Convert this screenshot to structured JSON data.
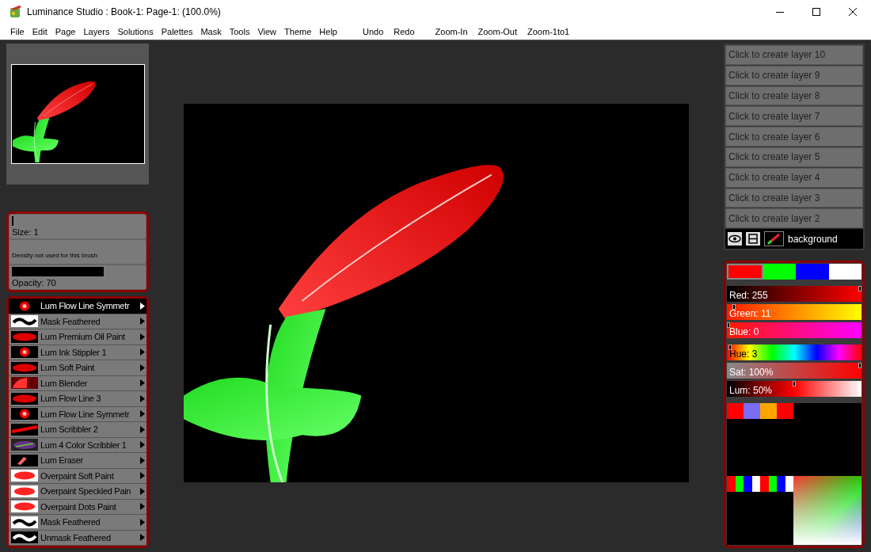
{
  "window": {
    "title": "Luminance Studio : Book-1: Page-1:  (100.0%)"
  },
  "menu": [
    "File",
    "Edit",
    "Page",
    "Layers",
    "Solutions",
    "Palettes",
    "Mask",
    "Tools",
    "View",
    "Theme",
    "Help"
  ],
  "toolbar": [
    "Undo",
    "Redo",
    "Zoom-In",
    "Zoom-Out",
    "Zoom-1to1"
  ],
  "brush_settings": {
    "size": {
      "label": "Size: 1",
      "level": 0.01
    },
    "density_note": "Density not used for this brush",
    "opacity": {
      "label": "Opacity: 70",
      "level": 0.7
    }
  },
  "brushes": [
    {
      "name": "Lum Flow Line Symmetr",
      "kind": "burst",
      "selected": true
    },
    {
      "name": "Mask Feathered",
      "kind": "wave-dark",
      "selected": false
    },
    {
      "name": "Lum Premium Oil Paint",
      "kind": "soft",
      "selected": false
    },
    {
      "name": "Lum Ink Stippler 1",
      "kind": "burst",
      "selected": false
    },
    {
      "name": "Lum Soft Paint",
      "kind": "soft",
      "selected": false
    },
    {
      "name": "Lum Blender",
      "kind": "blend",
      "selected": false
    },
    {
      "name": "Lum Flow Line 3",
      "kind": "soft",
      "selected": false
    },
    {
      "name": "Lum Flow Line Symmetr",
      "kind": "burst",
      "selected": false
    },
    {
      "name": "Lum Scribbler 2",
      "kind": "streak",
      "selected": false
    },
    {
      "name": "Lum 4 Color Scribbler 1",
      "kind": "multi",
      "selected": false
    },
    {
      "name": "Lum Eraser",
      "kind": "eraser",
      "selected": false
    },
    {
      "name": "Overpaint Soft Paint",
      "kind": "overpaint",
      "selected": false
    },
    {
      "name": "Overpaint Speckled Pain",
      "kind": "overpaint",
      "selected": false
    },
    {
      "name": "Overpaint Dots Paint",
      "kind": "overpaint",
      "selected": false
    },
    {
      "name": "Mask Feathered",
      "kind": "wave-dark",
      "selected": false
    },
    {
      "name": "Unmask Feathered",
      "kind": "wave-light",
      "selected": false
    }
  ],
  "layers": [
    {
      "label": "Click to create layer 10",
      "selected": false
    },
    {
      "label": "Click to create layer 9",
      "selected": false
    },
    {
      "label": "Click to create layer 8",
      "selected": false
    },
    {
      "label": "Click to create layer 7",
      "selected": false
    },
    {
      "label": "Click to create layer 6",
      "selected": false
    },
    {
      "label": "Click to create layer 5",
      "selected": false
    },
    {
      "label": "Click to create layer 4",
      "selected": false
    },
    {
      "label": "Click to create layer 3",
      "selected": false
    },
    {
      "label": "Click to create layer 2",
      "selected": false
    },
    {
      "label": "background",
      "selected": true
    }
  ],
  "color_swatches": [
    {
      "color": "#ff0000",
      "selected": true
    },
    {
      "color": "#00ff00",
      "selected": false
    },
    {
      "color": "#0000ff",
      "selected": false
    },
    {
      "color": "#ffffff",
      "selected": false
    }
  ],
  "rgb_sliders": [
    {
      "label": "Red: 255",
      "level": 1.0,
      "kind": "red"
    },
    {
      "label": "Green: 11",
      "level": 0.04,
      "kind": "green"
    },
    {
      "label": "Blue: 0",
      "level": 0.0,
      "kind": "blue"
    }
  ],
  "hsl_sliders": [
    {
      "label": "Hue: 3",
      "level": 0.01,
      "kind": "hue"
    },
    {
      "label": "Sat: 100%",
      "level": 1.0,
      "kind": "sat"
    },
    {
      "label": "Lum: 50%",
      "level": 0.5,
      "kind": "lum"
    }
  ],
  "recent_colors": [
    {
      "color": "#ff0000"
    },
    {
      "color": "#7b6cf6"
    },
    {
      "color": "#ffa500"
    },
    {
      "color": "#ff0000"
    }
  ],
  "basic_colors": [
    {
      "color": "#ff0000"
    },
    {
      "color": "#00ff00"
    },
    {
      "color": "#0000ff"
    },
    {
      "color": "#ffffff"
    },
    {
      "color": "#ff0000"
    },
    {
      "color": "#00ff00"
    },
    {
      "color": "#0000ff"
    },
    {
      "color": "#ffffff"
    }
  ]
}
